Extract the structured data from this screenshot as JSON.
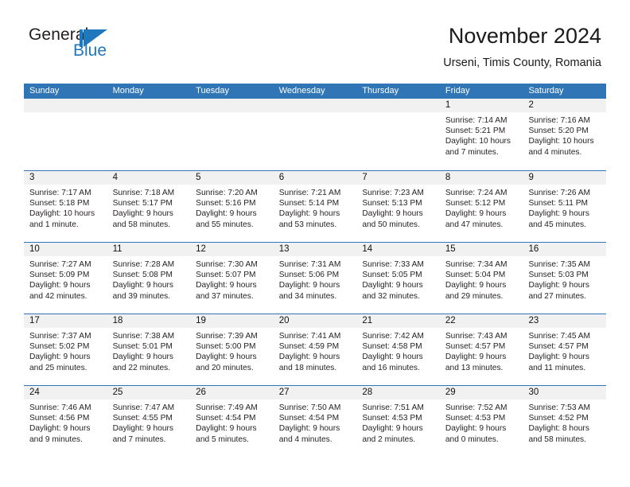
{
  "brand": {
    "name_part1": "General",
    "name_part2": "Blue",
    "logo_icon": "blue-triangle-logo"
  },
  "header": {
    "title": "November 2024",
    "subtitle": "Urseni, Timis County, Romania"
  },
  "colors": {
    "header_blue": "#3075b5",
    "brand_blue": "#1f77bd",
    "day_band_gray": "#f1f1f1",
    "text": "#231f20"
  },
  "weekdays": [
    "Sunday",
    "Monday",
    "Tuesday",
    "Wednesday",
    "Thursday",
    "Friday",
    "Saturday"
  ],
  "weeks": [
    [
      {
        "day": "",
        "empty": true
      },
      {
        "day": "",
        "empty": true
      },
      {
        "day": "",
        "empty": true
      },
      {
        "day": "",
        "empty": true
      },
      {
        "day": "",
        "empty": true
      },
      {
        "day": "1",
        "sunrise": "Sunrise: 7:14 AM",
        "sunset": "Sunset: 5:21 PM",
        "daylight1": "Daylight: 10 hours",
        "daylight2": "and 7 minutes."
      },
      {
        "day": "2",
        "sunrise": "Sunrise: 7:16 AM",
        "sunset": "Sunset: 5:20 PM",
        "daylight1": "Daylight: 10 hours",
        "daylight2": "and 4 minutes."
      }
    ],
    [
      {
        "day": "3",
        "sunrise": "Sunrise: 7:17 AM",
        "sunset": "Sunset: 5:18 PM",
        "daylight1": "Daylight: 10 hours",
        "daylight2": "and 1 minute."
      },
      {
        "day": "4",
        "sunrise": "Sunrise: 7:18 AM",
        "sunset": "Sunset: 5:17 PM",
        "daylight1": "Daylight: 9 hours",
        "daylight2": "and 58 minutes."
      },
      {
        "day": "5",
        "sunrise": "Sunrise: 7:20 AM",
        "sunset": "Sunset: 5:16 PM",
        "daylight1": "Daylight: 9 hours",
        "daylight2": "and 55 minutes."
      },
      {
        "day": "6",
        "sunrise": "Sunrise: 7:21 AM",
        "sunset": "Sunset: 5:14 PM",
        "daylight1": "Daylight: 9 hours",
        "daylight2": "and 53 minutes."
      },
      {
        "day": "7",
        "sunrise": "Sunrise: 7:23 AM",
        "sunset": "Sunset: 5:13 PM",
        "daylight1": "Daylight: 9 hours",
        "daylight2": "and 50 minutes."
      },
      {
        "day": "8",
        "sunrise": "Sunrise: 7:24 AM",
        "sunset": "Sunset: 5:12 PM",
        "daylight1": "Daylight: 9 hours",
        "daylight2": "and 47 minutes."
      },
      {
        "day": "9",
        "sunrise": "Sunrise: 7:26 AM",
        "sunset": "Sunset: 5:11 PM",
        "daylight1": "Daylight: 9 hours",
        "daylight2": "and 45 minutes."
      }
    ],
    [
      {
        "day": "10",
        "sunrise": "Sunrise: 7:27 AM",
        "sunset": "Sunset: 5:09 PM",
        "daylight1": "Daylight: 9 hours",
        "daylight2": "and 42 minutes."
      },
      {
        "day": "11",
        "sunrise": "Sunrise: 7:28 AM",
        "sunset": "Sunset: 5:08 PM",
        "daylight1": "Daylight: 9 hours",
        "daylight2": "and 39 minutes."
      },
      {
        "day": "12",
        "sunrise": "Sunrise: 7:30 AM",
        "sunset": "Sunset: 5:07 PM",
        "daylight1": "Daylight: 9 hours",
        "daylight2": "and 37 minutes."
      },
      {
        "day": "13",
        "sunrise": "Sunrise: 7:31 AM",
        "sunset": "Sunset: 5:06 PM",
        "daylight1": "Daylight: 9 hours",
        "daylight2": "and 34 minutes."
      },
      {
        "day": "14",
        "sunrise": "Sunrise: 7:33 AM",
        "sunset": "Sunset: 5:05 PM",
        "daylight1": "Daylight: 9 hours",
        "daylight2": "and 32 minutes."
      },
      {
        "day": "15",
        "sunrise": "Sunrise: 7:34 AM",
        "sunset": "Sunset: 5:04 PM",
        "daylight1": "Daylight: 9 hours",
        "daylight2": "and 29 minutes."
      },
      {
        "day": "16",
        "sunrise": "Sunrise: 7:35 AM",
        "sunset": "Sunset: 5:03 PM",
        "daylight1": "Daylight: 9 hours",
        "daylight2": "and 27 minutes."
      }
    ],
    [
      {
        "day": "17",
        "sunrise": "Sunrise: 7:37 AM",
        "sunset": "Sunset: 5:02 PM",
        "daylight1": "Daylight: 9 hours",
        "daylight2": "and 25 minutes."
      },
      {
        "day": "18",
        "sunrise": "Sunrise: 7:38 AM",
        "sunset": "Sunset: 5:01 PM",
        "daylight1": "Daylight: 9 hours",
        "daylight2": "and 22 minutes."
      },
      {
        "day": "19",
        "sunrise": "Sunrise: 7:39 AM",
        "sunset": "Sunset: 5:00 PM",
        "daylight1": "Daylight: 9 hours",
        "daylight2": "and 20 minutes."
      },
      {
        "day": "20",
        "sunrise": "Sunrise: 7:41 AM",
        "sunset": "Sunset: 4:59 PM",
        "daylight1": "Daylight: 9 hours",
        "daylight2": "and 18 minutes."
      },
      {
        "day": "21",
        "sunrise": "Sunrise: 7:42 AM",
        "sunset": "Sunset: 4:58 PM",
        "daylight1": "Daylight: 9 hours",
        "daylight2": "and 16 minutes."
      },
      {
        "day": "22",
        "sunrise": "Sunrise: 7:43 AM",
        "sunset": "Sunset: 4:57 PM",
        "daylight1": "Daylight: 9 hours",
        "daylight2": "and 13 minutes."
      },
      {
        "day": "23",
        "sunrise": "Sunrise: 7:45 AM",
        "sunset": "Sunset: 4:57 PM",
        "daylight1": "Daylight: 9 hours",
        "daylight2": "and 11 minutes."
      }
    ],
    [
      {
        "day": "24",
        "sunrise": "Sunrise: 7:46 AM",
        "sunset": "Sunset: 4:56 PM",
        "daylight1": "Daylight: 9 hours",
        "daylight2": "and 9 minutes."
      },
      {
        "day": "25",
        "sunrise": "Sunrise: 7:47 AM",
        "sunset": "Sunset: 4:55 PM",
        "daylight1": "Daylight: 9 hours",
        "daylight2": "and 7 minutes."
      },
      {
        "day": "26",
        "sunrise": "Sunrise: 7:49 AM",
        "sunset": "Sunset: 4:54 PM",
        "daylight1": "Daylight: 9 hours",
        "daylight2": "and 5 minutes."
      },
      {
        "day": "27",
        "sunrise": "Sunrise: 7:50 AM",
        "sunset": "Sunset: 4:54 PM",
        "daylight1": "Daylight: 9 hours",
        "daylight2": "and 4 minutes."
      },
      {
        "day": "28",
        "sunrise": "Sunrise: 7:51 AM",
        "sunset": "Sunset: 4:53 PM",
        "daylight1": "Daylight: 9 hours",
        "daylight2": "and 2 minutes."
      },
      {
        "day": "29",
        "sunrise": "Sunrise: 7:52 AM",
        "sunset": "Sunset: 4:53 PM",
        "daylight1": "Daylight: 9 hours",
        "daylight2": "and 0 minutes."
      },
      {
        "day": "30",
        "sunrise": "Sunrise: 7:53 AM",
        "sunset": "Sunset: 4:52 PM",
        "daylight1": "Daylight: 8 hours",
        "daylight2": "and 58 minutes."
      }
    ]
  ]
}
